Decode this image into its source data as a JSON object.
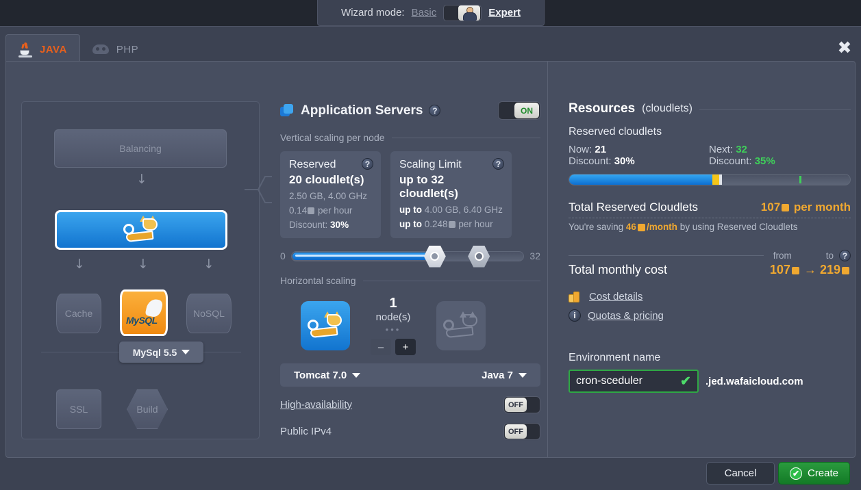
{
  "wizard": {
    "label": "Wizard mode:",
    "basic": "Basic",
    "expert": "Expert",
    "toggle_icon": "person-icon"
  },
  "tabs": [
    {
      "label": "JAVA",
      "icon": "java-cup-icon",
      "active": true
    },
    {
      "label": "PHP",
      "icon": "php-elephant-icon",
      "active": false
    }
  ],
  "close_icon": "close-icon",
  "topology": {
    "balancing": "Balancing",
    "app_server_icon": "tomcat-icon",
    "cache": "Cache",
    "mysql_icon": "mysql-icon",
    "nosql": "NoSQL",
    "ssl": "SSL",
    "build": "Build",
    "db_dropdown": "MySql 5.5"
  },
  "center": {
    "section_title": "Application Servers",
    "section_toggle": "ON",
    "vertical_label": "Vertical scaling per node",
    "reserved": {
      "title": "Reserved",
      "main": "20 cloudlet(s)",
      "line1": "2.50 GB, 4.00 GHz",
      "line2_value": "0.14",
      "line2_suffix": "per hour",
      "discount_label": "Discount:",
      "discount_value": "30%"
    },
    "scaling_limit": {
      "title": "Scaling Limit",
      "main": "up to 32 cloudlet(s)",
      "line1_prefix": "up to",
      "line1": "4.00 GB, 6.40 GHz",
      "line2_prefix": "up to",
      "line2_value": "0.248",
      "line2_suffix": "per hour"
    },
    "slider_min": "0",
    "slider_max": "32",
    "horizontal_label": "Horizontal scaling",
    "node_count": "1",
    "node_unit": "node(s)",
    "minus": "–",
    "plus": "+",
    "stack": "Tomcat 7.0",
    "engine": "Java 7",
    "high_availability": "High-availability",
    "high_availability_state": "OFF",
    "public_ipv4": "Public IPv4",
    "public_ipv4_state": "OFF"
  },
  "resources": {
    "title": "Resources",
    "title_sub": "(cloudlets)",
    "reserved_cloudlets_label": "Reserved cloudlets",
    "now_label": "Now:",
    "now_value": "21",
    "now_discount_label": "Discount:",
    "now_discount_value": "30%",
    "next_label": "Next:",
    "next_value": "32",
    "next_discount_label": "Discount:",
    "next_discount_value": "35%",
    "total_reserved_label": "Total Reserved Cloudlets",
    "total_reserved_value": "107",
    "total_reserved_unit": "per month",
    "saving_prefix": "You're saving",
    "saving_value": "46",
    "saving_unit": "/month",
    "saving_suffix": "by using Reserved Cloudlets",
    "from_label": "from",
    "to_label": "to",
    "total_cost_label": "Total monthly cost",
    "cost_from": "107",
    "cost_arrow": "→",
    "cost_to": "219",
    "cost_details": "Cost details",
    "cost_details_icon": "coins-icon",
    "quotas_pricing": "Quotas & pricing",
    "quotas_icon": "info-icon",
    "env_name_label": "Environment name",
    "env_name_value": "cron-sceduler",
    "env_name_placeholder": "Environment name",
    "env_domain": ".jed.wafaicloud.com",
    "env_valid_icon": "check-icon"
  },
  "footer": {
    "cancel": "Cancel",
    "create": "Create",
    "create_icon": "check-circle-icon"
  },
  "colors": {
    "accent_orange": "#e8601c",
    "money_orange": "#f0a830",
    "green": "#3fcf5a",
    "blue": "#1274cf",
    "panel": "#474e60",
    "dialog": "#3c4252",
    "backdrop": "#22262f"
  }
}
